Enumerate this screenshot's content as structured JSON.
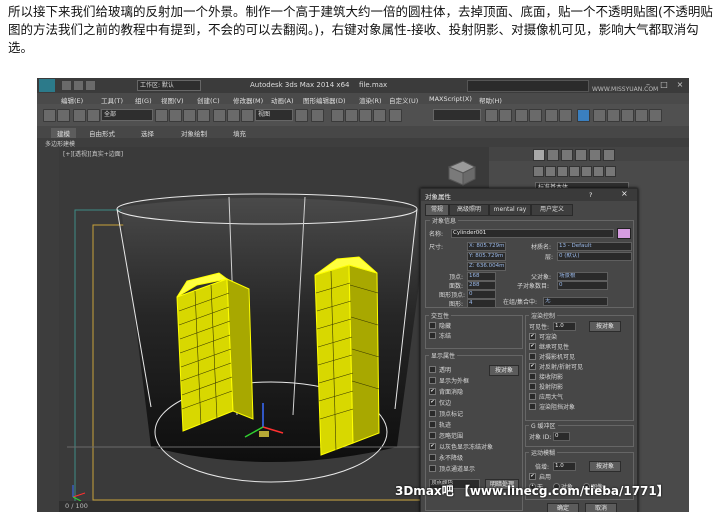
{
  "intro": {
    "text": "所以接下来我们给玻璃的反射加一个外景。制作一个高于建筑大约一倍的圆柱体，去掉顶面、底面，贴一个不透明贴图(不透明贴图的方法我们之前的教程中有提到，不会的可以去翻阅。)，右键对象属性-接收、投射阴影、对摄像机可见，影响大气都取消勾选。"
  },
  "app": {
    "title": "Autodesk 3ds Max  2014 x64",
    "file": "file.max",
    "workspace": "工作区: 默认"
  },
  "menu": [
    "编辑(E)",
    "工具(T)",
    "组(G)",
    "视图(V)",
    "创建(C)",
    "修改器(M)",
    "动画(A)",
    "图形编辑器(D)",
    "渲染(R)",
    "自定义(U)",
    "MAXScript(X)",
    "帮助(H)"
  ],
  "toolbar": {
    "selection_filter": "全部",
    "view_dropdown": "视图"
  },
  "ribbon": {
    "tabs": [
      "建模",
      "自由形式",
      "选择",
      "对象绘制",
      "填充"
    ],
    "active_tab": "建模",
    "sub_label": "多边形建模"
  },
  "viewport": {
    "label": "[+][透视][真实+边面]"
  },
  "command_panel": {
    "category": "标准基本体"
  },
  "timeline": {
    "frame": "0 / 100"
  },
  "dialog": {
    "title": "对象属性",
    "help": "?",
    "close": "×",
    "tabs": [
      "常规",
      "高级照明",
      "mental ray",
      "用户定义"
    ],
    "active_tab": "常规",
    "object_info": {
      "group_label": "对象信息",
      "name_label": "名称:",
      "name_value": "Cylinder001",
      "dimensions_label": "尺寸:",
      "dim_x": "X: 805.729m",
      "dim_y": "Y: 805.729m",
      "dim_z": "Z: 636.004m",
      "material_label": "材质名:",
      "material_value": "13 - Default",
      "layer_label": "层:",
      "layer_value": "0 (默认)",
      "vertices_label": "顶点:",
      "vertices_value": "168",
      "faces_label": "面数:",
      "faces_value": "288",
      "parent_label": "父对象:",
      "parent_value": "场景根",
      "children_label": "子对象数目:",
      "children_value": "0",
      "shape_vertices_label": "图形顶点:",
      "shape_vertices_value": "0",
      "shape_faces_label": "图形:",
      "shape_faces_value": "4",
      "group_name_label": "在组/集合中:",
      "group_name_value": "无"
    },
    "interaction": {
      "group_label": "交互性",
      "hide": "隐藏",
      "freeze": "冻结"
    },
    "display": {
      "group_label": "显示属性",
      "by_object_button": "按对象",
      "items": [
        {
          "label": "透明",
          "checked": false
        },
        {
          "label": "显示为外框",
          "checked": false
        },
        {
          "label": "背面消隐",
          "checked": true
        },
        {
          "label": "仅边",
          "checked": true
        },
        {
          "label": "顶点标记",
          "checked": false
        },
        {
          "label": "轨迹",
          "checked": false
        },
        {
          "label": "忽略范围",
          "checked": false
        },
        {
          "label": "以灰色显示冻结对象",
          "checked": true
        },
        {
          "label": "永不降级",
          "checked": false
        },
        {
          "label": "顶点通道显示",
          "checked": false
        }
      ],
      "vertex_color_dropdown": "顶点颜色",
      "shaded_button": "明暗处理"
    },
    "render": {
      "group_label": "渲染控制",
      "visibility_label": "可见性:",
      "visibility_value": "1.0",
      "by_object_button": "按对象",
      "items": [
        {
          "label": "可渲染",
          "checked": true
        },
        {
          "label": "继承可见性",
          "checked": true
        },
        {
          "label": "对摄影机可见",
          "checked": false
        },
        {
          "label": "对反射/折射可见",
          "checked": true
        },
        {
          "label": "接收阴影",
          "checked": false
        },
        {
          "label": "投射阴影",
          "checked": false
        },
        {
          "label": "应用大气",
          "checked": false
        },
        {
          "label": "渲染阻挡对象",
          "checked": false
        }
      ]
    },
    "gbuffer": {
      "group_label": "G 缓冲区",
      "object_id_label": "对象 ID:",
      "object_id_value": "0"
    },
    "motion_blur": {
      "group_label": "运动模糊",
      "multiplier_label": "倍增:",
      "multiplier_value": "1.0",
      "by_object_button": "按对象",
      "enabled_label": "启用",
      "none_label": "无",
      "object_label": "对象",
      "image_label": "图像"
    },
    "ok_button": "确定",
    "cancel_button": "取消"
  },
  "watermark": {
    "text": "3Dmax吧 【www.linecg.com/tieba/1771】",
    "corner": "WWW.MISSYUAN.COM"
  },
  "colors": {
    "building": "#ffff00",
    "wire": "#e8e8e8",
    "object_color": "#d69ce0"
  }
}
